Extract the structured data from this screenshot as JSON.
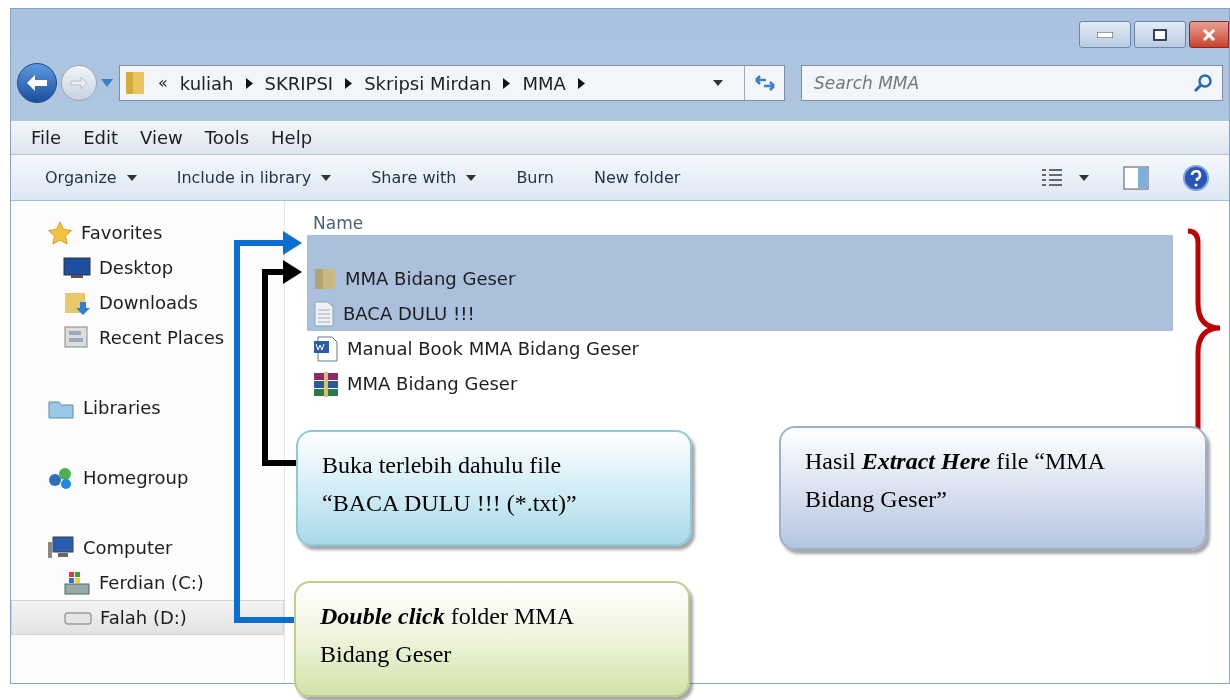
{
  "address_bar": {
    "overflow": "«",
    "crumbs": [
      "kuliah",
      "SKRIPSI",
      "Skripsi Mirdan",
      "MMA"
    ]
  },
  "search": {
    "placeholder": "Search MMA"
  },
  "menu": [
    "File",
    "Edit",
    "View",
    "Tools",
    "Help"
  ],
  "toolbar": [
    {
      "label": "Organize",
      "dropdown": true
    },
    {
      "label": "Include in library",
      "dropdown": true
    },
    {
      "label": "Share with",
      "dropdown": true
    },
    {
      "label": "Burn",
      "dropdown": false
    },
    {
      "label": "New folder",
      "dropdown": false
    }
  ],
  "sidebar": {
    "groups": [
      {
        "label": "Favorites",
        "kind": "star",
        "selected": false,
        "children": [
          {
            "label": "Desktop",
            "kind": "desktop",
            "selected": false
          },
          {
            "label": "Downloads",
            "kind": "downloads",
            "selected": false
          },
          {
            "label": "Recent Places",
            "kind": "recent",
            "selected": false
          }
        ]
      },
      {
        "label": "Libraries",
        "kind": "libraries",
        "selected": false
      },
      {
        "label": "Homegroup",
        "kind": "homegroup",
        "selected": false
      },
      {
        "label": "Computer",
        "kind": "computer",
        "selected": false,
        "children": [
          {
            "label": "Ferdian (C:)",
            "kind": "system-drive",
            "selected": false
          },
          {
            "label": "Falah (D:)",
            "kind": "drive",
            "selected": true
          }
        ]
      }
    ]
  },
  "file_list": {
    "column": "Name",
    "files": [
      {
        "name": "MMA Bidang Geser",
        "kind": "folder",
        "selected": true
      },
      {
        "name": "BACA DULU !!!",
        "kind": "text",
        "selected": true
      },
      {
        "name": "Manual Book MMA Bidang Geser",
        "kind": "word",
        "selected": false
      },
      {
        "name": "MMA Bidang Geser",
        "kind": "archive",
        "selected": false
      }
    ]
  },
  "callouts": [
    {
      "text": "Buka terlebih dahulu file “BACA DULU !!! (*.txt)”",
      "kind": "cyan"
    },
    {
      "text": "Hasil **Extract Here** file “MMA Bidang Geser”",
      "kind": "slate"
    },
    {
      "text": "**Double click** folder MMA Bidang Geser",
      "kind": "green"
    }
  ]
}
